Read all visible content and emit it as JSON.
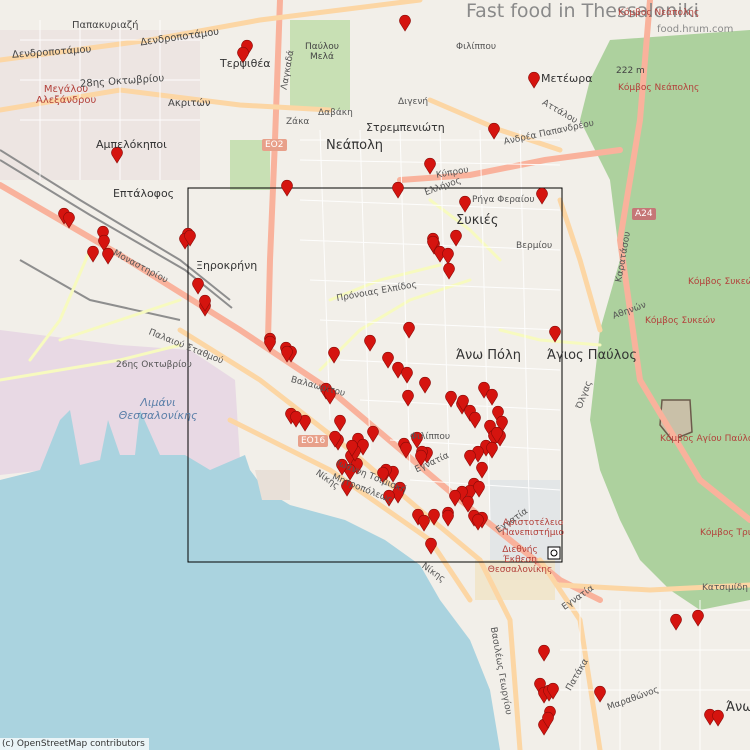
{
  "title": "Fast food in Thessaloniki",
  "subtitle": "food.hrum.com",
  "attribution": "(c) OpenStreetMap contributors",
  "colors": {
    "land": "#f2efe9",
    "sea": "#aad3df",
    "park": "#add19e",
    "marker": "#d5140f",
    "box": "#000000",
    "road_major": "#f9b29c",
    "road_secondary": "#f7fabf"
  },
  "labels": {
    "papakiriazi": "Παπακυριαζή",
    "dendropotamou1": "Δενδροποτάμου",
    "dendropotamou2": "Δενδροποτάμου",
    "oktovriou_28": "28ης Οκτωβρίου",
    "megalou": "Μεγάλου Αλεξάνδρου",
    "akriton": "Ακριτών",
    "terpsithea": "Τερψιθέα",
    "pavlou_mela": "Παύλου Μελά",
    "lagkada": "Λαγκαδά",
    "davaki": "Δαβάκη",
    "zaka": "Ζάκα",
    "digeni": "Διγενή",
    "neapoli": "Νεάπολη",
    "strempeniotis": "Στρεμπενιώτη",
    "meteora": "Μετέωρα",
    "filippou_n": "Φιλίππου",
    "kyprou": "Κύπρου",
    "eo2": "ΕΟ2",
    "ampelokipoi": "Αμπελόκηποι",
    "eptalofos": "Επτάλοφος",
    "andrea_pap": "Ανδρέα Παπανδρέου",
    "attalou": "Αττάλου",
    "rigas": "Ρήγα Φεραίου",
    "sykies": "Συκιές",
    "vermiou": "Βερμίου",
    "xirokrini": "Ξηροκρήνη",
    "monastiriou": "Μοναστηρίου",
    "pronoias": "Πρόνοιας Ελπίδος",
    "ano_poli": "Άνω Πόλη",
    "agios_pavlos": "Άγιος Παύλος",
    "palaiou_stathmou": "Παλαιού Σταθμού",
    "oktovriou_26": "26ης Οκτωβρίου",
    "limani": "Λιμάνι Θεσσαλονίκης",
    "valaoritou": "Βαλαωρίτου",
    "eo16": "ΕΟ16",
    "egnatia1": "Εγνατία",
    "egnatia2": "Εγνατία",
    "egnatia3": "Εγνατία",
    "filippou_c": "Φιλίππου",
    "tsimiski": "Ιωάννη Τσιμισκή",
    "mitropoleos": "Μητροπόλεως",
    "nikis1": "Νίκης",
    "nikis2": "Νίκης",
    "aristotelio": "Αριστοτέλειο Πανεπιστήμιο",
    "diethnis": "Διεθνής Έκθεση Θεσσαλονίκης",
    "kombos_neapolis1": "Κόμβος Νεάπολης",
    "kombos_neapolis2": "Κόμβος Νεάπολης",
    "elev_222": "222 m",
    "a24": "Α24",
    "kombos_sykeon1": "Κόμβος Συκεών",
    "kombos_sykeon2": "Κόμβος Συκεών",
    "kombos_agiou_pavlou": "Κόμβος Αγίου Παύλου",
    "kombos_tria": "Κόμβος Τρια",
    "katsimidi": "Κατσιμίδη",
    "pataka": "Πατάκα",
    "vasileos_georgiou": "Βασιλέως Γεωργίου",
    "ano_toumpa": "Άνω Τ",
    "karatasou": "Καρατάσου",
    "athinon": "Αθηνών",
    "ellinos": "Ελλήνος",
    "marathonos": "Μαραθώνος",
    "olga": "Όλγας"
  },
  "marker_count": 120,
  "selection_box_label": "map selection area"
}
